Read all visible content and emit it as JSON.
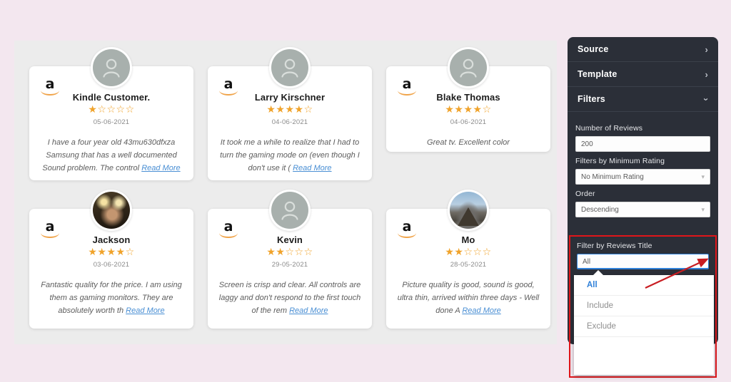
{
  "page": {
    "background_color": "#f3e7ef",
    "content_background": "#ececec"
  },
  "reviews": [
    {
      "source_icon": "amazon-logo-icon",
      "avatar_type": "default-person-icon",
      "name": "Kindle Customer.",
      "rating": 1,
      "max_rating": 5,
      "date": "05-06-2021",
      "text": "I have a four year old 43mu630dfxza Samsung that has a well documented Sound problem. The control ",
      "read_more": "Read More"
    },
    {
      "source_icon": "amazon-logo-icon",
      "avatar_type": "default-person-icon",
      "name": "Larry Kirschner",
      "rating": 4,
      "max_rating": 5,
      "date": "04-06-2021",
      "text": "It took me a while to realize that I had to turn the gaming mode on (even though I don't use it ( ",
      "read_more": "Read More"
    },
    {
      "source_icon": "amazon-logo-icon",
      "avatar_type": "default-person-icon",
      "name": "Blake Thomas",
      "rating": 4,
      "max_rating": 5,
      "date": "04-06-2021",
      "text": "Great tv. Excellent color",
      "read_more": ""
    },
    {
      "source_icon": "amazon-logo-icon",
      "avatar_type": "photo-avatar",
      "name": "Jackson",
      "rating": 4,
      "max_rating": 5,
      "date": "03-06-2021",
      "text": "Fantastic quality for the price. I am using them as gaming monitors. They are absolutely worth th ",
      "read_more": "Read More"
    },
    {
      "source_icon": "amazon-logo-icon",
      "avatar_type": "default-person-icon",
      "name": "Kevin",
      "rating": 2,
      "max_rating": 5,
      "date": "29-05-2021",
      "text": "Screen is crisp and clear. All controls are laggy and don't respond to the first touch of the rem ",
      "read_more": "Read More"
    },
    {
      "source_icon": "amazon-logo-icon",
      "avatar_type": "photo-avatar",
      "name": "Mo",
      "rating": 2,
      "max_rating": 5,
      "date": "28-05-2021",
      "text": "Picture quality is good, sound is good, ultra thin, arrived within three days - Well done A ",
      "read_more": "Read More"
    }
  ],
  "sidebar": {
    "accordion": [
      {
        "label": "Source",
        "state": "collapsed",
        "chevron": "chevron-right-icon"
      },
      {
        "label": "Template",
        "state": "collapsed",
        "chevron": "chevron-right-icon"
      },
      {
        "label": "Filters",
        "state": "expanded",
        "chevron": "chevron-down-icon"
      }
    ],
    "filters": {
      "number_of_reviews": {
        "label": "Number of Reviews",
        "value": "200"
      },
      "minimum_rating": {
        "label": "Filters by Minimum Rating",
        "value": "No Minimum Rating"
      },
      "order": {
        "label": "Order",
        "value": "Descending"
      },
      "reviews_title": {
        "label": "Filter by Reviews Title",
        "value": "All",
        "open": true,
        "options": [
          "All",
          "Include",
          "Exclude"
        ],
        "selected": "All"
      }
    }
  },
  "annotations": {
    "highlight_box_color": "#e0161a",
    "arrow_color": "#c81d22"
  }
}
